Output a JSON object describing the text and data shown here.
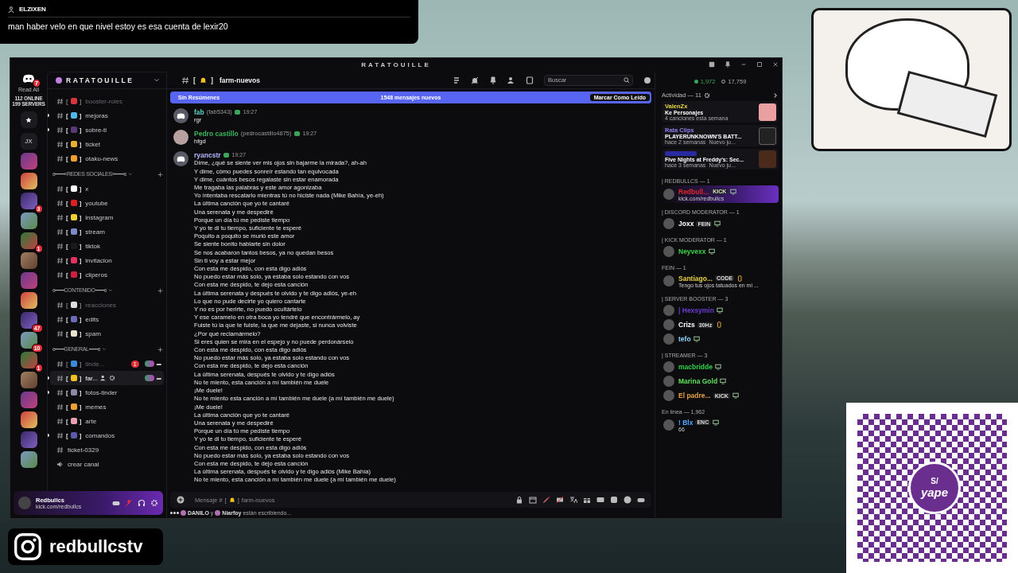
{
  "chat_overlay": {
    "user": "ELZIXEN",
    "message": "man haber velo en que nivel estoy es esa cuenta de lexir20"
  },
  "window": {
    "title": "RATATOUILLE"
  },
  "rail": {
    "logo_badge": "7",
    "read_all": "Read All",
    "online": "112 ONLINE",
    "servers_count": "199 SERVERS",
    "shortcuts": [
      {
        "kind": "favorites"
      },
      {
        "kind": "initials",
        "label": "JX"
      }
    ],
    "servers": [
      {
        "kind": "image"
      },
      {
        "kind": "image"
      },
      {
        "kind": "image",
        "badge": "3"
      },
      {
        "kind": "image"
      },
      {
        "kind": "image",
        "badge": "1"
      },
      {
        "kind": "image"
      },
      {
        "kind": "image"
      },
      {
        "kind": "image"
      },
      {
        "kind": "image",
        "badge": "47"
      },
      {
        "kind": "image",
        "badge": "10"
      },
      {
        "kind": "image",
        "badge": "1"
      },
      {
        "kind": "image"
      },
      {
        "kind": "image"
      },
      {
        "kind": "image"
      },
      {
        "kind": "image"
      },
      {
        "kind": "image"
      }
    ]
  },
  "server": {
    "name": "RATATOUILLE"
  },
  "channels": [
    {
      "kind": "text",
      "name": "booster-roles",
      "bracket_l": "[",
      "bracket_r": "]",
      "color": "#d8333f",
      "muted": true,
      "unread": false,
      "selected": false
    },
    {
      "kind": "text",
      "name": "mejoras",
      "bracket_l": "[",
      "bracket_r": "]",
      "color": "#4fb8e8",
      "muted": false,
      "unread": true,
      "selected": false
    },
    {
      "kind": "text",
      "name": "sobre-ti",
      "bracket_l": "[",
      "bracket_r": "]",
      "color": "#5a3a7a",
      "muted": false,
      "unread": true,
      "selected": false
    },
    {
      "kind": "text",
      "name": "ticket",
      "bracket_l": "[",
      "bracket_r": "]",
      "color": "#e8b030",
      "muted": false,
      "unread": false,
      "selected": false
    },
    {
      "kind": "text",
      "name": "otaku-news",
      "bracket_l": "[",
      "bracket_r": "]",
      "color": "#f0a030",
      "muted": false,
      "unread": false,
      "selected": false
    },
    {
      "kind": "category",
      "name": "ɞ━━━«REDES SOCIALES»━━━ɞ"
    },
    {
      "kind": "text",
      "name": "x",
      "bracket_l": "[",
      "bracket_r": "]",
      "color": "#ffffff",
      "muted": false,
      "unread": false,
      "selected": false
    },
    {
      "kind": "text",
      "name": "youtube",
      "bracket_l": "[",
      "bracket_r": "]",
      "color": "#e02020",
      "muted": false,
      "unread": false,
      "selected": false
    },
    {
      "kind": "text",
      "name": "instagram",
      "bracket_l": "[",
      "bracket_r": "]",
      "color": "#f0d030",
      "muted": false,
      "unread": false,
      "selected": false
    },
    {
      "kind": "text",
      "name": "stream",
      "bracket_l": "[",
      "bracket_r": "]",
      "color": "#7a8cc8",
      "muted": false,
      "unread": false,
      "selected": false
    },
    {
      "kind": "text",
      "name": "tiktok",
      "bracket_l": "[",
      "bracket_r": "]",
      "color": "#1a1a1a",
      "muted": false,
      "unread": false,
      "selected": false
    },
    {
      "kind": "text",
      "name": "invitacion",
      "bracket_l": "[",
      "bracket_r": "]",
      "color": "#e83060",
      "muted": false,
      "unread": false,
      "selected": false
    },
    {
      "kind": "text",
      "name": "cliperos",
      "bracket_l": "[",
      "bracket_r": "]",
      "color": "#d02040",
      "muted": false,
      "unread": false,
      "selected": false
    },
    {
      "kind": "category",
      "name": "ɞ━━━CONTENIDO━━━ɞ"
    },
    {
      "kind": "text",
      "name": "reacciones",
      "bracket_l": "[",
      "bracket_r": "]",
      "color": "#dddddd",
      "muted": true,
      "unread": false,
      "selected": false
    },
    {
      "kind": "text",
      "name": "edits",
      "bracket_l": "[",
      "bracket_r": "]",
      "color": "#6a6ab8",
      "muted": false,
      "unread": false,
      "selected": false
    },
    {
      "kind": "text",
      "name": "spam",
      "bracket_l": "[",
      "bracket_r": "]",
      "color": "#e8e0d0",
      "muted": false,
      "unread": false,
      "selected": false
    },
    {
      "kind": "category",
      "name": "ɞ━━━GENERAL━━━ɞ"
    },
    {
      "kind": "text",
      "name": "tinde...",
      "bracket_l": "[",
      "bracket_r": "]",
      "color": "#3a8ad8",
      "muted": true,
      "unread": false,
      "selected": false,
      "badge": "1",
      "more": "•••"
    },
    {
      "kind": "text",
      "name": "far...",
      "bracket_l": "[",
      "bracket_r": "]",
      "color": "#f0c020",
      "muted": false,
      "unread": true,
      "selected": true,
      "more": "•••"
    },
    {
      "kind": "text",
      "name": "fotos-tinder",
      "bracket_l": "[",
      "bracket_r": "]",
      "color": "#8a8aa8",
      "muted": false,
      "unread": true,
      "selected": false
    },
    {
      "kind": "text",
      "name": "memes",
      "bracket_l": "[",
      "bracket_r": "]",
      "color": "#f0a030",
      "muted": false,
      "unread": false,
      "selected": false
    },
    {
      "kind": "text",
      "name": "arte",
      "bracket_l": "[",
      "bracket_r": "]",
      "color": "#e8a0b0",
      "muted": false,
      "unread": false,
      "selected": false
    },
    {
      "kind": "text",
      "name": "comandos",
      "bracket_l": "[",
      "bracket_r": "]",
      "color": "#5a5aa8",
      "muted": false,
      "unread": true,
      "selected": false
    },
    {
      "kind": "plain",
      "name": "ticket-0329",
      "muted": false,
      "unread": false,
      "selected": false
    },
    {
      "kind": "voice",
      "name": "crear canal",
      "muted": false,
      "unread": false,
      "selected": false
    }
  ],
  "user_panel": {
    "name": "Redbullcs",
    "status": "kick.com/redbullcs",
    "mic_muted": true
  },
  "header": {
    "channel": "farm-nuevos",
    "bracket_l": "[",
    "bracket_r": "]",
    "search_placeholder": "Buscar"
  },
  "banner": {
    "summaries": "Sin Resúmenes",
    "count": "1548 mensajes nuevos",
    "mark_read": "Marcar Como Leído"
  },
  "messages": [
    {
      "author": "fab",
      "color": "#5fd3c8",
      "handle": "(fab5343)",
      "time": "19:27",
      "kind": "default-avatar",
      "lines": [
        "rgr"
      ]
    },
    {
      "author": "Pedro castillo",
      "color": "#3bb55c",
      "handle": "(pedrocastillo4875)",
      "time": "19:27",
      "kind": "photo-avatar",
      "lines": [
        "hfgd"
      ]
    },
    {
      "author": "ryancstr",
      "color": "#b8b8ff",
      "time": "19:27",
      "kind": "default-avatar",
      "lines": [
        "Dime, ¿qué se siente ver mis ojos sin bajarme la mirada?, ah-ah",
        "Y dime, cómo puedes sonreír estando tan equivocada",
        "Y dime, cuántos besos regalaste sin estar enamorada",
        "Me tragaba las palabras y este amor agonizaba",
        "Yo intentaba rescatarlo mientras tú no hiciste nada (Mike Bahía, ye-eh)",
        "La última canción que yo te cantaré",
        "Una serenata y me despediré",
        "Porque un día tú me pediste tiempo",
        "Y yo te di tu tiempo, suficiente te esperé",
        "Poquito a poquito se murió este amor",
        "Se siente bonito hablarte sin dolor",
        "Se nos acabaron tantos besos, ya no quedan besos",
        "Sin ti voy a estar mejor",
        "Con esta me despido, con esta digo adiós",
        "No puedo estar más solo, ya estaba solo estando con vos",
        "Con esta me despido, te dejo esta canción",
        "La última serenata y después te olvido y te digo adiós, ye-eh",
        "Lo que no pude decirte yo quiero cantarte",
        "Y no es por herirte, no puedo ocultártelo",
        "Y ese caramelo en otra boca yo tendré que encontrármelo, ay",
        "Fuiste tú la que te fuiste, la que me dejaste, si nunca volviste",
        "¿Por qué reclamármelo?",
        "Si eres quien se mira en el espejo y no puede perdonárselo",
        "Con esta me despido, con esta digo adiós",
        "No puedo estar más solo, ya estaba solo estando con vos",
        "Con esta me despido, te dejo esta canción",
        "La última serenata, después te olvido y te digo adiós",
        "No te miento, esta canción a mí también me duele",
        "¡Me duele!",
        "No te miento esta canción a mí también me duele (a mí también me duele)",
        "¡Me duele!",
        "La última canción que yo te cantaré",
        "Una serenata y me despediré",
        "Porque un día tú me pediste tiempo",
        "Y yo te di tu tiempo, suficiente te esperé",
        "Con esta me despido, con esta digo adiós",
        "No puedo estar más solo, ya estaba solo estando con vos",
        "Con esta me despido, te dejo esta canción",
        "La última serenata, después te olvido y te digo adiós (Mike Bahía)",
        "No te miento, esta canción a mí también me duele (a mí también me duele)"
      ]
    }
  ],
  "composer": {
    "prefix": "Mensaje #",
    "bracket_l": "[",
    "bracket_r": "]",
    "channel": "farm-nuevos"
  },
  "typing": {
    "users": [
      "DANILO",
      "Niarfoy"
    ],
    "joiner": "y",
    "suffix": "están escribiendo..."
  },
  "member_list": {
    "online": "1,972",
    "total": "17,759",
    "activity_title": "Actividad — 11",
    "activities": [
      {
        "user": "ValenZx",
        "color": "#e8d84a",
        "title": "Ke Personajes",
        "detail": "4 canciones esta semana"
      },
      {
        "user": "Rata Clips",
        "color": "#8c7cf0",
        "title": "PLAYERUNKNOWN'S BATT...",
        "detail": "hace 2 semanas",
        "extra": "Nuevo ju..."
      },
      {
        "title": "Five Nights at Freddy's: Sec...",
        "detail": "hace 3 semanas",
        "extra": "Nuevo ju..."
      }
    ],
    "groups": [
      {
        "title": "| REDBULLCS — 1",
        "members": [
          {
            "name": "Redbull...",
            "color": "#e02828",
            "tag": "KICK",
            "sub": "kick.com/redbullcs",
            "streaming": true,
            "kind": "desktop"
          }
        ]
      },
      {
        "title": "| DISCORD MODERATOR — 1",
        "members": [
          {
            "name": "Joxx",
            "color": "#ffffff",
            "tag": "FEIN",
            "streaming": false,
            "kind": "desktop"
          }
        ]
      },
      {
        "title": "| KICK MODERATOR — 1",
        "members": [
          {
            "name": "Neyvexx",
            "color": "#3bd14a",
            "streaming": false,
            "kind": "desktop"
          }
        ]
      },
      {
        "title": "FEIN — 1",
        "members": [
          {
            "name": "Santiago...",
            "color": "#e5d34a",
            "tag": "CODE",
            "sub": "Tengo tus ojos tatuados en mi ...",
            "streaming": false,
            "kind": "mobile"
          }
        ]
      },
      {
        "title": "| SERVER BOOSTER — 3",
        "members": [
          {
            "name": "| Hexsymin",
            "color": "#6a3dd0",
            "streaming": false,
            "kind": "desktop"
          },
          {
            "name": "Crizs",
            "color": "#ffffff",
            "tag": "30Hz",
            "streaming": false,
            "kind": "mobile"
          },
          {
            "name": "tefo",
            "color": "#8fd0ff",
            "streaming": false,
            "kind": "desktop"
          }
        ]
      },
      {
        "title": "| STREAMER — 3",
        "members": [
          {
            "name": "macbridde",
            "color": "#2ed34a",
            "streaming": false,
            "kind": "desktop"
          },
          {
            "name": "Marina Gold",
            "color": "#5fe05a",
            "streaming": false,
            "kind": "desktop"
          },
          {
            "name": "El padre...",
            "color": "#e8a24a",
            "tag": "KICK",
            "streaming": false,
            "kind": "desktop"
          }
        ]
      },
      {
        "title": "En línea — 1,962",
        "members": [
          {
            "name": "! Blx",
            "color": "#4aa8ff",
            "tag": "ENC",
            "sub": "66",
            "streaming": false,
            "kind": "desktop"
          }
        ]
      }
    ]
  },
  "instagram": {
    "handle": "redbullcstv"
  },
  "qr": {
    "currency": "S/",
    "brand": "yape"
  }
}
